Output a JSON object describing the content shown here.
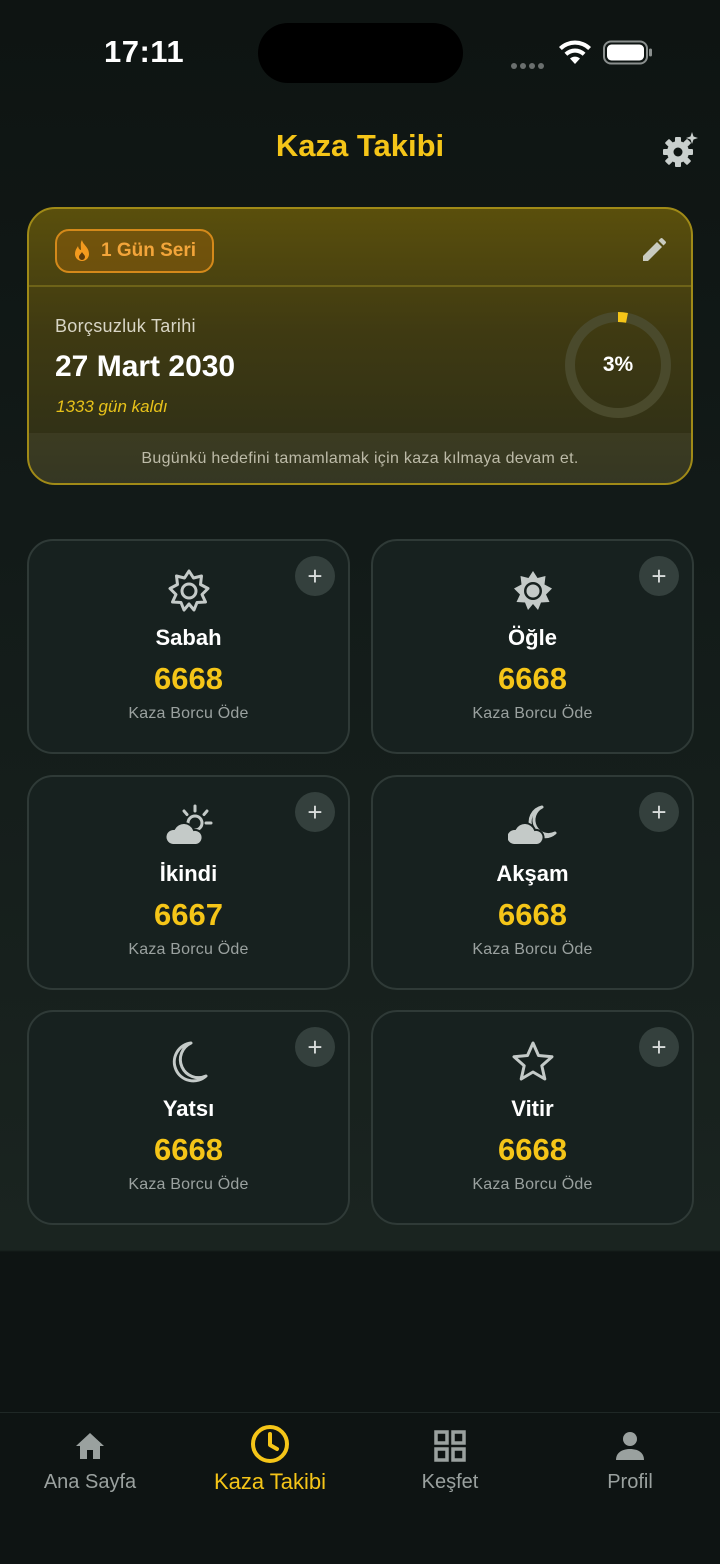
{
  "status_bar": {
    "time": "17:11"
  },
  "header": {
    "title": "Kaza Takibi"
  },
  "summary": {
    "streak_label": "1 Gün Seri",
    "debt_label": "Borçsuzluk Tarihi",
    "debt_date": "27 Mart 2030",
    "days_left": "1333 gün kaldı",
    "progress_text": "3%",
    "progress_fraction": 0.03,
    "footer_text": "Bugünkü hedefini tamamlamak için kaza kılmaya devam et."
  },
  "prayers": [
    {
      "name": "Sabah",
      "count": "6668",
      "sub": "Kaza Borcu Öde",
      "icon": "sun-outline-icon"
    },
    {
      "name": "Öğle",
      "count": "6668",
      "sub": "Kaza Borcu Öde",
      "icon": "sun-filled-icon"
    },
    {
      "name": "İkindi",
      "count": "6667",
      "sub": "Kaza Borcu Öde",
      "icon": "cloud-sun-icon"
    },
    {
      "name": "Akşam",
      "count": "6668",
      "sub": "Kaza Borcu Öde",
      "icon": "cloud-moon-icon"
    },
    {
      "name": "Yatsı",
      "count": "6668",
      "sub": "Kaza Borcu Öde",
      "icon": "moon-icon"
    },
    {
      "name": "Vitir",
      "count": "6668",
      "sub": "Kaza Borcu Öde",
      "icon": "star-icon"
    }
  ],
  "nav": [
    {
      "label": "Ana Sayfa",
      "icon": "home-icon",
      "active": false
    },
    {
      "label": "Kaza Takibi",
      "icon": "clock-icon",
      "active": true
    },
    {
      "label": "Keşfet",
      "icon": "grid-icon",
      "active": false
    },
    {
      "label": "Profil",
      "icon": "person-icon",
      "active": false
    }
  ],
  "colors": {
    "accent": "#f5c518",
    "background": "#0e1413",
    "card": "#17211f",
    "streak": "#f3a53a"
  }
}
